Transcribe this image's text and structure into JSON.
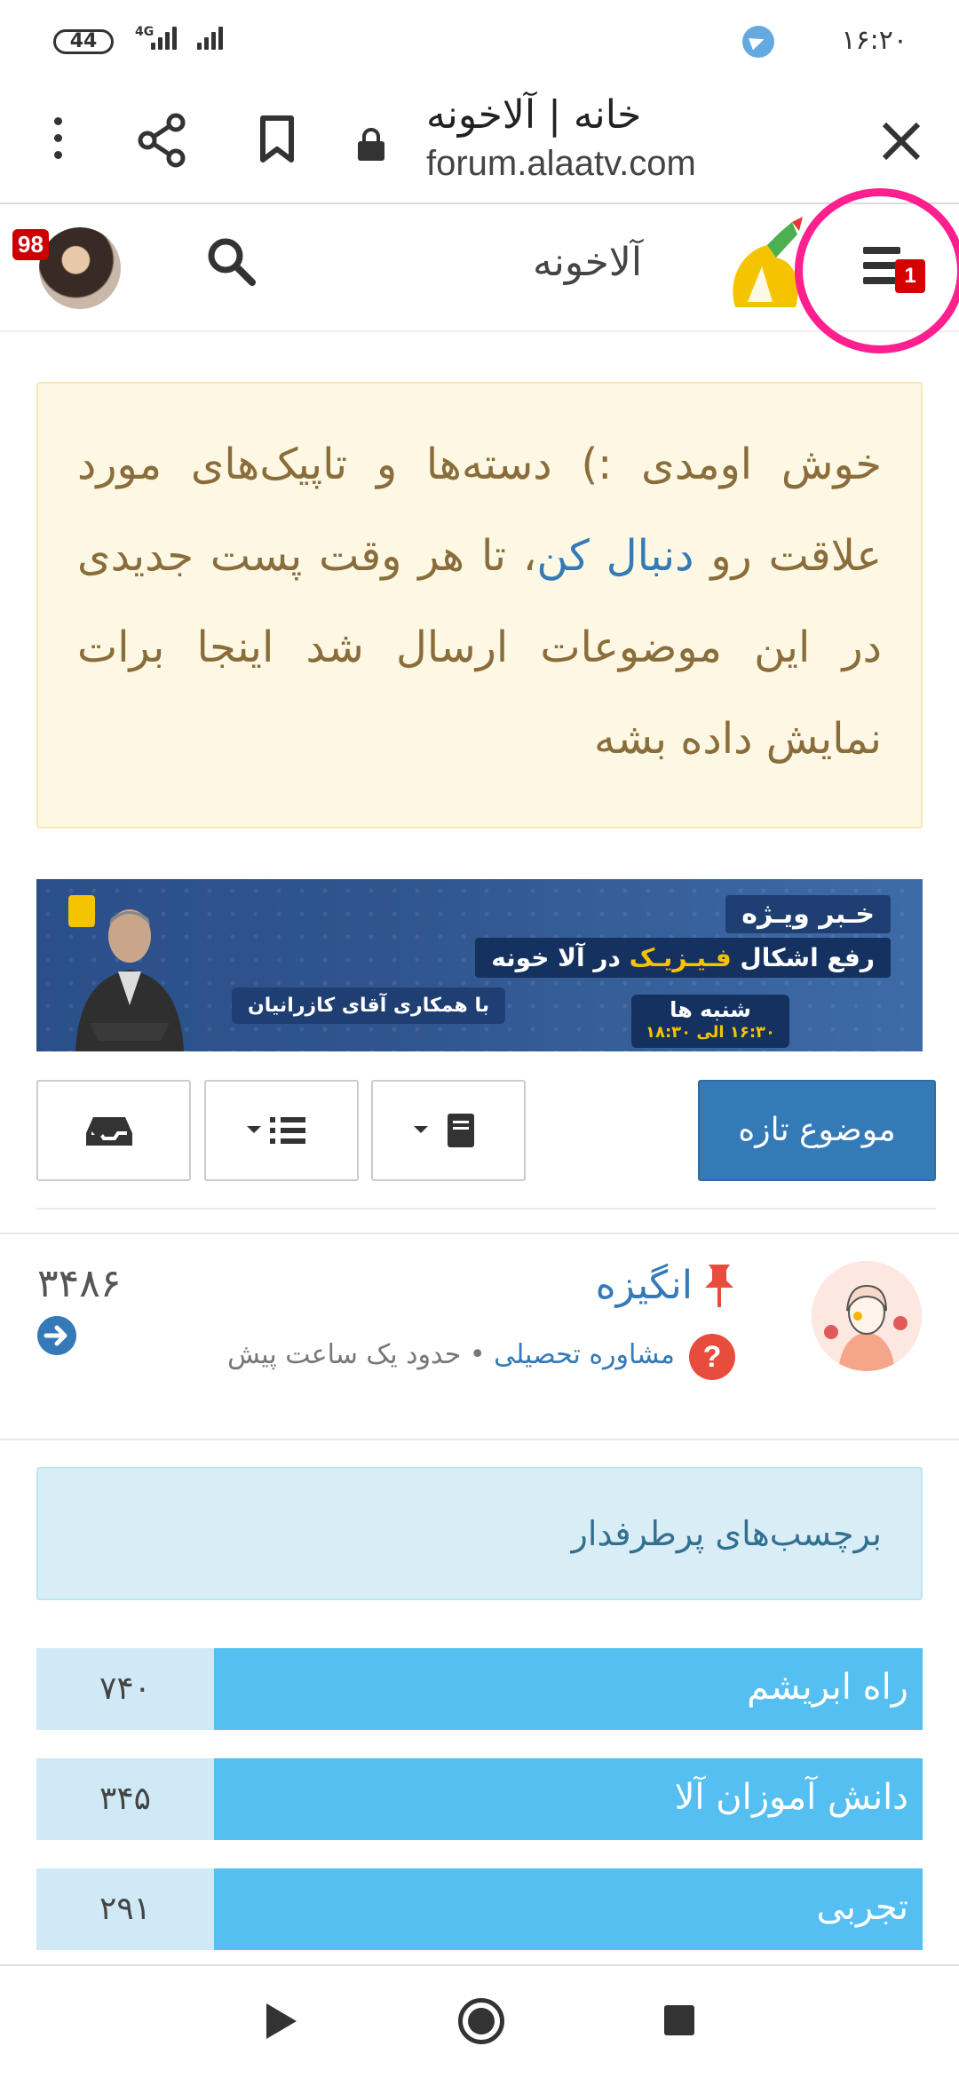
{
  "status_bar": {
    "battery": "44",
    "network": "4G",
    "time": "۱۶:۲۰"
  },
  "browser": {
    "page_title": "خانه | آلاخونه",
    "url": "forum.alaatv.com"
  },
  "header": {
    "site_title": "آلاخونه",
    "notifications_badge": "98",
    "menu_badge": "1"
  },
  "welcome": {
    "text_before": "خوش اومدی :) دسته‌ها و تاپیک‌های مورد علاقت رو ",
    "link": "دنبال کن",
    "text_after": "، تا هر وقت پست جدیدی در این موضوعات ارسال شد اینجا برات نمایش داده بشه"
  },
  "banner": {
    "headline": "خـبر ویـژه",
    "sub_prefix": "رفع اشکال ",
    "sub_highlight": "فـیـزیـک",
    "sub_suffix": " در آلا خونه",
    "credit": "با همکاری آقای کازرانیان",
    "date": "شنبه ها",
    "time": "۱۶:۳۰ الی ۱۸:۳۰"
  },
  "toolbar": {
    "new_topic": "موضوع تازه"
  },
  "topic": {
    "title": "انگیزه",
    "category": "مشاوره تحصیلی",
    "separator": " • ",
    "time": "حدود یک ساعت پیش",
    "count": "۳۴۸۶"
  },
  "tags": {
    "header": "برچسب‌های پرطرفدار",
    "items": [
      {
        "label": "راه ابریشم",
        "count": "۷۴۰"
      },
      {
        "label": "دانش آموزان آلا",
        "count": "۳۴۵"
      },
      {
        "label": "تجربی",
        "count": "۲۹۱"
      }
    ]
  },
  "colors": {
    "accent": "#337ab7",
    "welcome_bg": "#fcf8e3",
    "tag_bar": "#54bff0",
    "highlight_ring": "#ff1f8e"
  }
}
